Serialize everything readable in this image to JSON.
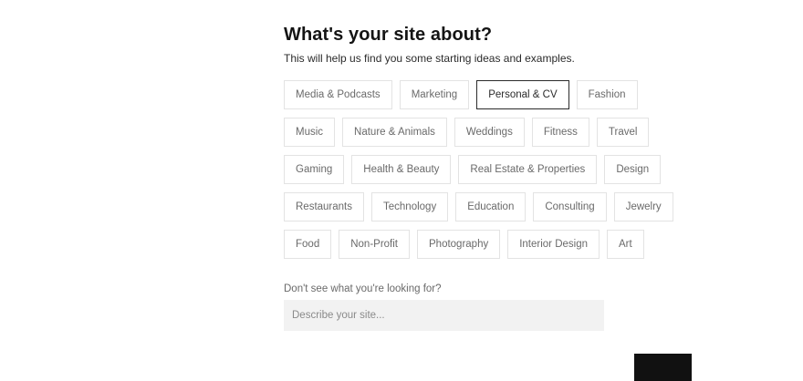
{
  "header": {
    "title": "What's your site about?",
    "subtitle": "This will help us find you some starting ideas and examples."
  },
  "categories": {
    "rows": [
      [
        {
          "label": "Media & Podcasts",
          "selected": false
        },
        {
          "label": "Marketing",
          "selected": false
        },
        {
          "label": "Personal & CV",
          "selected": true
        },
        {
          "label": "Fashion",
          "selected": false
        }
      ],
      [
        {
          "label": "Music",
          "selected": false
        },
        {
          "label": "Nature & Animals",
          "selected": false
        },
        {
          "label": "Weddings",
          "selected": false
        },
        {
          "label": "Fitness",
          "selected": false
        },
        {
          "label": "Travel",
          "selected": false
        }
      ],
      [
        {
          "label": "Gaming",
          "selected": false
        },
        {
          "label": "Health & Beauty",
          "selected": false
        },
        {
          "label": "Real Estate & Properties",
          "selected": false
        },
        {
          "label": "Design",
          "selected": false
        }
      ],
      [
        {
          "label": "Restaurants",
          "selected": false
        },
        {
          "label": "Technology",
          "selected": false
        },
        {
          "label": "Education",
          "selected": false
        },
        {
          "label": "Consulting",
          "selected": false
        },
        {
          "label": "Jewelry",
          "selected": false
        }
      ],
      [
        {
          "label": "Food",
          "selected": false
        },
        {
          "label": "Non-Profit",
          "selected": false
        },
        {
          "label": "Photography",
          "selected": false
        },
        {
          "label": "Interior Design",
          "selected": false
        },
        {
          "label": "Art",
          "selected": false
        }
      ]
    ]
  },
  "other": {
    "label": "Don't see what you're looking for?",
    "placeholder": "Describe your site...",
    "value": ""
  },
  "colors": {
    "selected_border": "#2b2b2b",
    "chip_border": "#e3e3e3",
    "input_background": "#f2f2f2",
    "primary_button": "#111111"
  }
}
